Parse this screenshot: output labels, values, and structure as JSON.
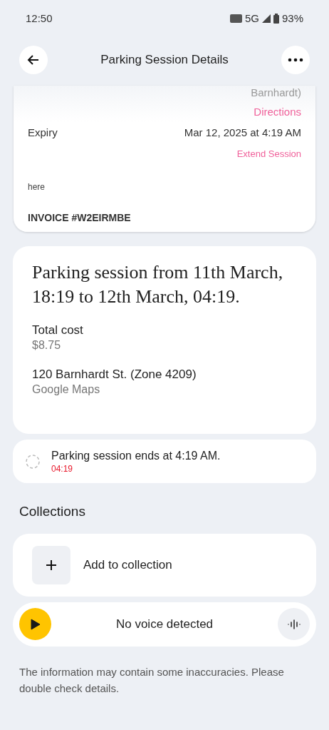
{
  "status_bar": {
    "time": "12:50",
    "network": "5G",
    "battery": "93%"
  },
  "header": {
    "title": "Parking Session Details"
  },
  "screenshot_card": {
    "address_tail": "Barnhardt)",
    "directions": "Directions",
    "expiry_label": "Expiry",
    "expiry_value": "Mar 12, 2025 at 4:19 AM",
    "extend": "Extend Session",
    "note": "here",
    "invoice": "INVOICE #W2EIRMBE"
  },
  "summary": {
    "headline": "Parking session from 11th March, 18:19 to 12th March, 04:19.",
    "fields": [
      {
        "label": "Total cost",
        "value": "$8.75"
      },
      {
        "label": "120 Barnhardt St. (Zone 4209)",
        "value": "Google Maps"
      }
    ]
  },
  "reminder": {
    "title": "Parking session ends at 4:19 AM.",
    "time": "04:19",
    "done": false
  },
  "collections": {
    "heading": "Collections",
    "add_label": "Add to collection"
  },
  "player": {
    "status": "No voice detected"
  },
  "disclaimer": "The information may contain some inaccuracies. Please double check details."
}
